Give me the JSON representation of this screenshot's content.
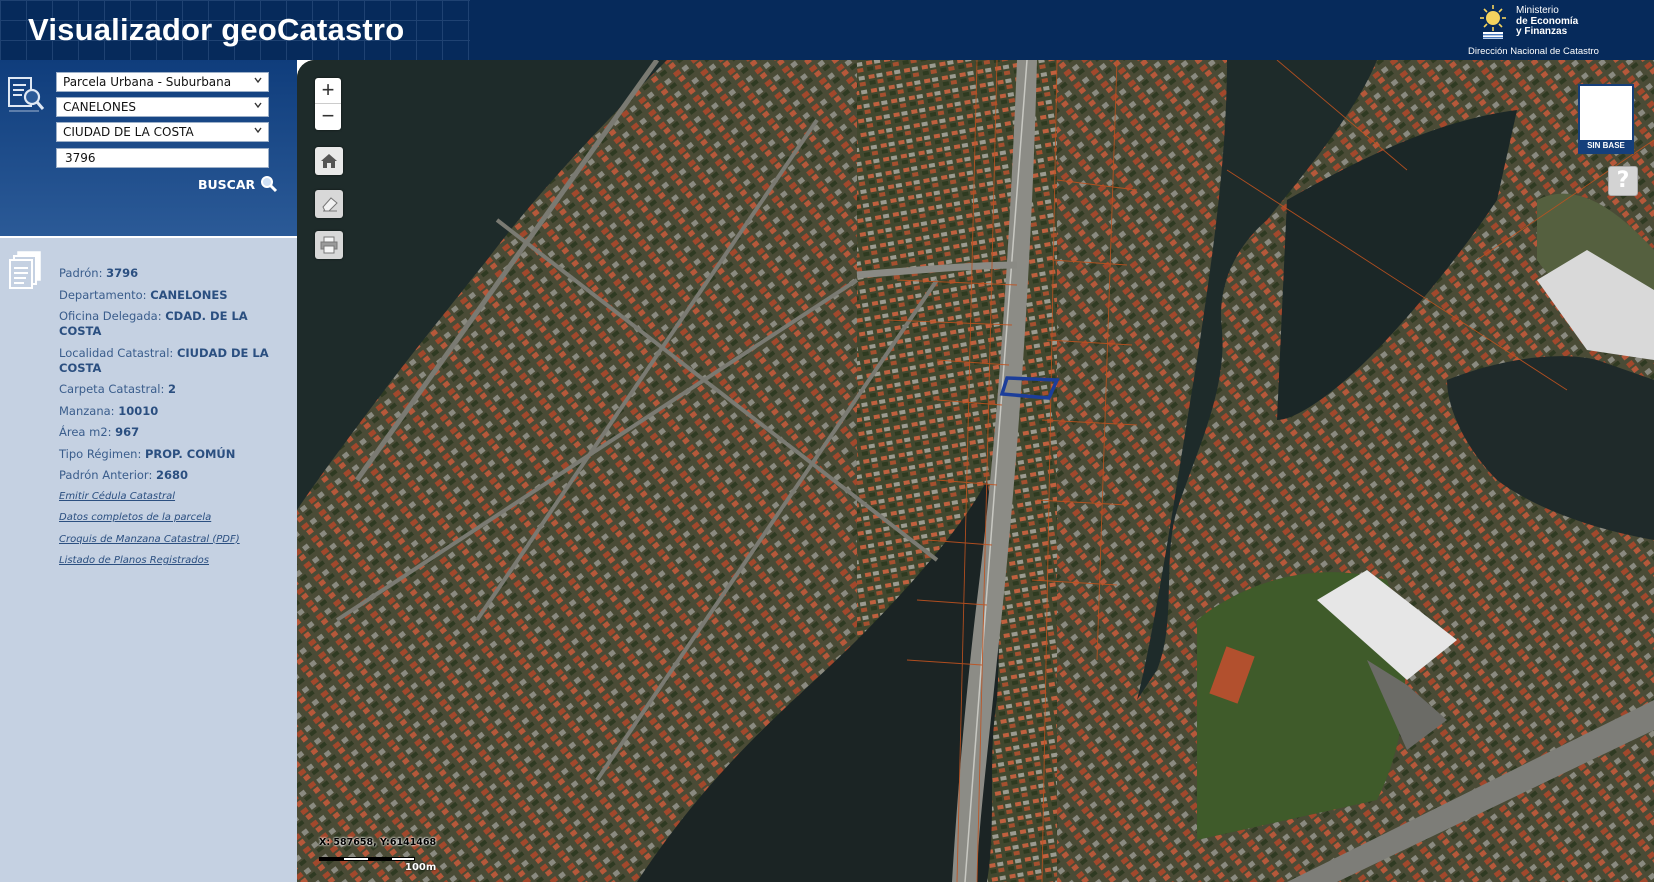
{
  "header": {
    "title": "Visualizador geoCatastro",
    "ministry_line1": "Ministerio",
    "ministry_line2": "de Economía",
    "ministry_line3": "y Finanzas",
    "department": "Dirección Nacional de Catastro"
  },
  "search": {
    "type_value": "Parcela Urbana - Suburbana",
    "departamento_value": "CANELONES",
    "localidad_value": "CIUDAD DE LA COSTA",
    "padron_value": "3796",
    "buscar_label": "BUSCAR"
  },
  "info": {
    "padron_label": "Padrón:",
    "padron_value": "3796",
    "departamento_label": "Departamento:",
    "departamento_value": "CANELONES",
    "oficina_label": "Oficina Delegada:",
    "oficina_value": "CDAD. DE LA COSTA",
    "localidad_label": "Localidad Catastral:",
    "localidad_value": "CIUDAD DE LA COSTA",
    "carpeta_label": "Carpeta Catastral:",
    "carpeta_value": "2",
    "manzana_label": "Manzana:",
    "manzana_value": "10010",
    "area_label": "Área m2:",
    "area_value": "967",
    "regimen_label": "Tipo Régimen:",
    "regimen_value": "PROP. COMÚN",
    "padron_anterior_label": "Padrón Anterior:",
    "padron_anterior_value": "2680",
    "links": [
      "Emitir Cédula Catastral",
      "Datos completos de la parcela",
      "Croquis de Manzana Catastral (PDF)",
      "Listado de Planos Registrados"
    ]
  },
  "map": {
    "zoom_in": "+",
    "zoom_out": "−",
    "basemap_label": "SIN BASE",
    "help_label": "?",
    "coords": "X: 587658, Y:6141468",
    "scale_label": "100m"
  },
  "colors": {
    "header_bg": "#062a5b",
    "panel_bg": "#c5d1e2",
    "parcel_line": "#c0521f",
    "selected_parcel": "#1c3e9a",
    "water": "#1e2b2a"
  }
}
